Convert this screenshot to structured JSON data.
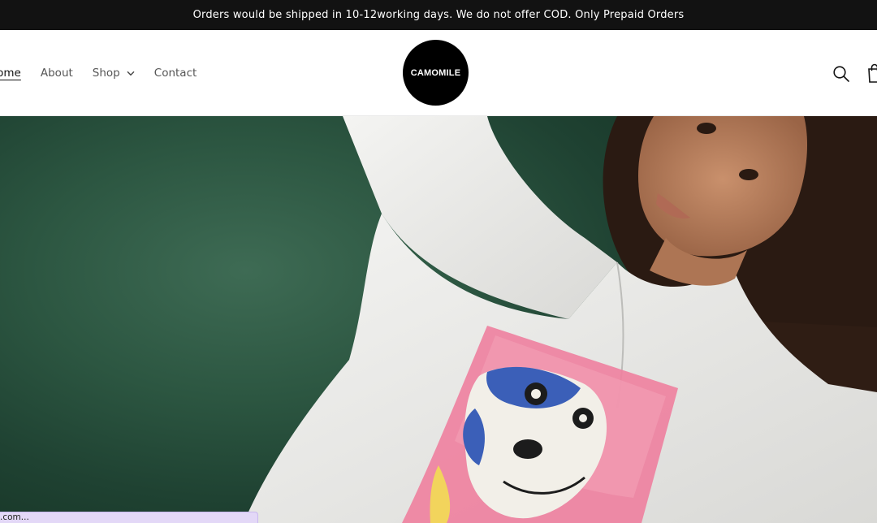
{
  "announcement": {
    "text": "Orders would be shipped in 10-12working days. We do not offer COD. Only Prepaid Orders"
  },
  "header": {
    "nav": [
      {
        "label": "Home",
        "active": true
      },
      {
        "label": "About",
        "active": false
      },
      {
        "label": "Shop",
        "active": false,
        "has_dropdown": true
      },
      {
        "label": "Contact",
        "active": false
      }
    ],
    "logo_text": "CAMOMILE",
    "icons": {
      "search": "search-icon",
      "cart": "cart-icon",
      "dropdown": "chevron-down-icon"
    }
  },
  "hero": {
    "image_alt": "Model in white shirt with dog print on green background"
  },
  "status_bar": {
    "text": ".com..."
  },
  "colors": {
    "announcement_bg": "#121212",
    "logo_bg": "#000000",
    "hero_bg": "#2c5641",
    "status_bar_bg": "#e3d8f7"
  }
}
